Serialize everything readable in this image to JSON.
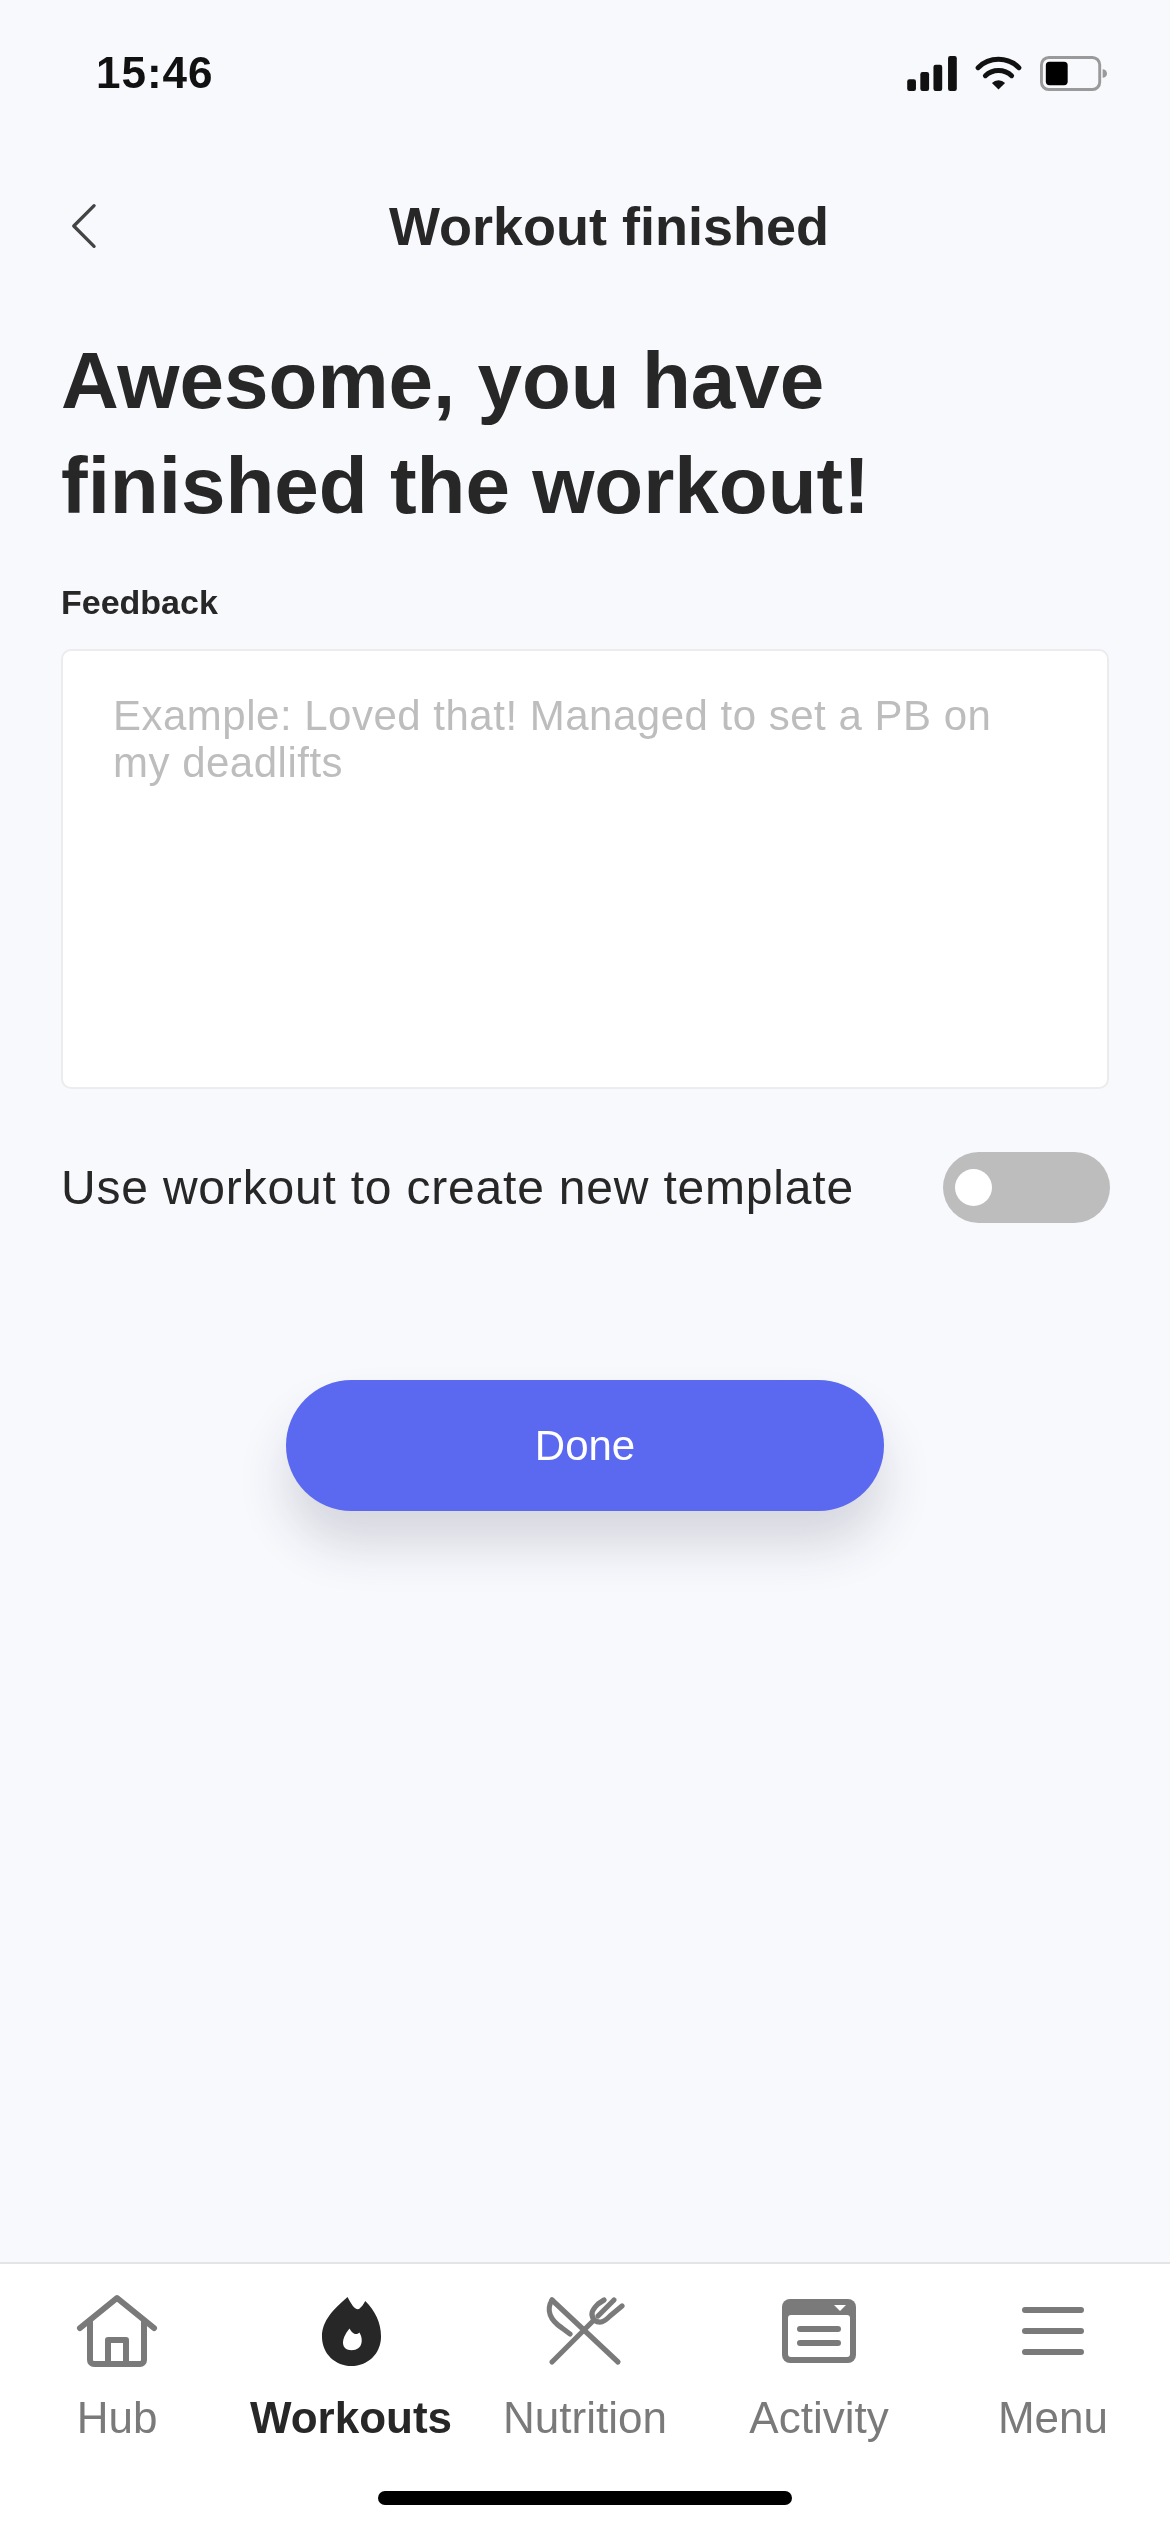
{
  "status_bar": {
    "time": "15:46"
  },
  "header": {
    "title": "Workout finished"
  },
  "heading": "Awesome, you have finished the workout!",
  "feedback": {
    "label": "Feedback",
    "placeholder": "Example: Loved that! Managed to set a PB on my deadlifts"
  },
  "template_toggle": {
    "label": "Use workout to create new template",
    "on": false
  },
  "done_button": {
    "label": "Done"
  },
  "tab_bar": {
    "items": [
      {
        "label": "Hub",
        "selected": false
      },
      {
        "label": "Workouts",
        "selected": true
      },
      {
        "label": "Nutrition",
        "selected": false
      },
      {
        "label": "Activity",
        "selected": false
      },
      {
        "label": "Menu",
        "selected": false
      }
    ]
  }
}
